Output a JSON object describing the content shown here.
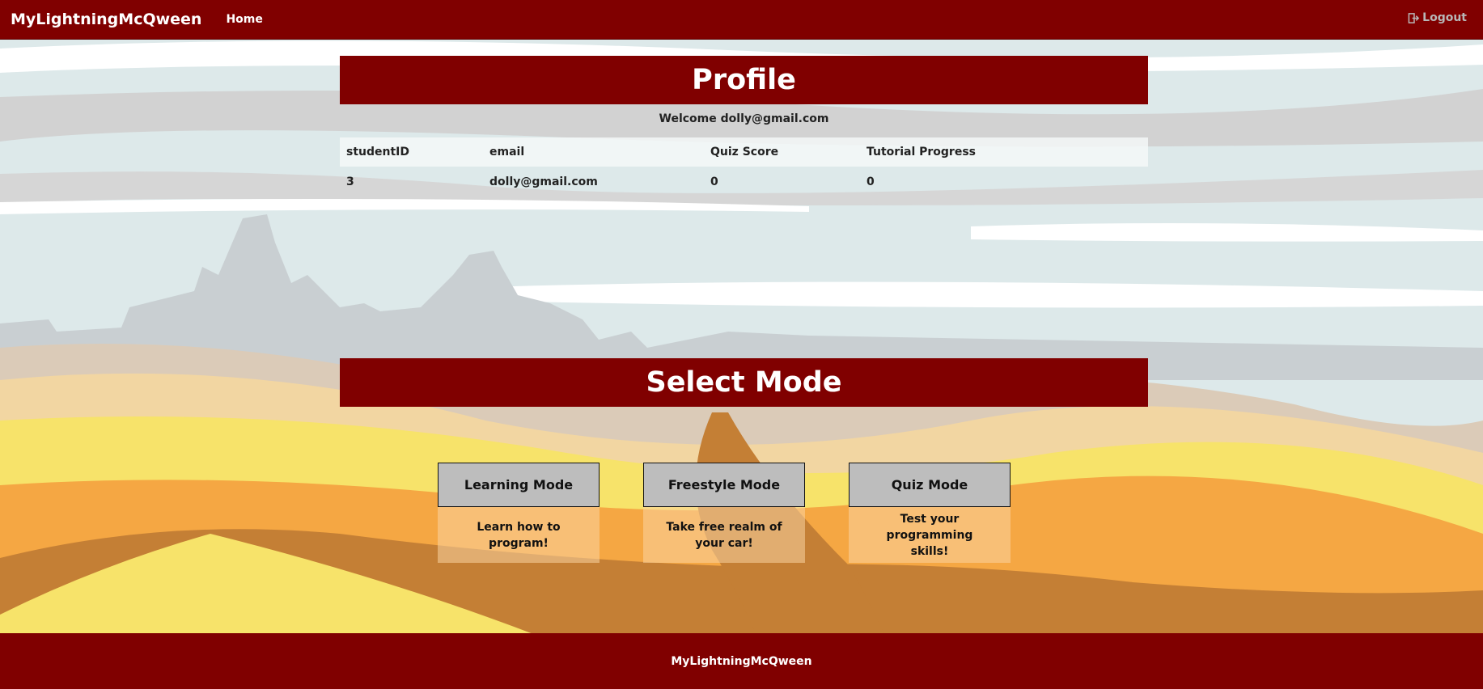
{
  "navbar": {
    "brand": "MyLightningMcQween",
    "home_label": "Home",
    "logout_label": "Logout",
    "color": "#800000"
  },
  "profile": {
    "title": "Profile",
    "welcome": "Welcome dolly@gmail.com",
    "columns": [
      "studentID",
      "email",
      "Quiz Score",
      "Tutorial Progress"
    ],
    "rows": [
      [
        "3",
        "dolly@gmail.com",
        "0",
        "0"
      ]
    ]
  },
  "select_mode": {
    "title": "Select Mode",
    "modes": [
      {
        "label": "Learning Mode",
        "desc": "Learn how to program!"
      },
      {
        "label": "Freestyle Mode",
        "desc": "Take free realm of your car!"
      },
      {
        "label": "Quiz Mode",
        "desc": "Test your programming skills!"
      }
    ]
  },
  "footer": {
    "text": "MyLightningMcQween"
  },
  "icons": {
    "logout": "logout-icon"
  }
}
